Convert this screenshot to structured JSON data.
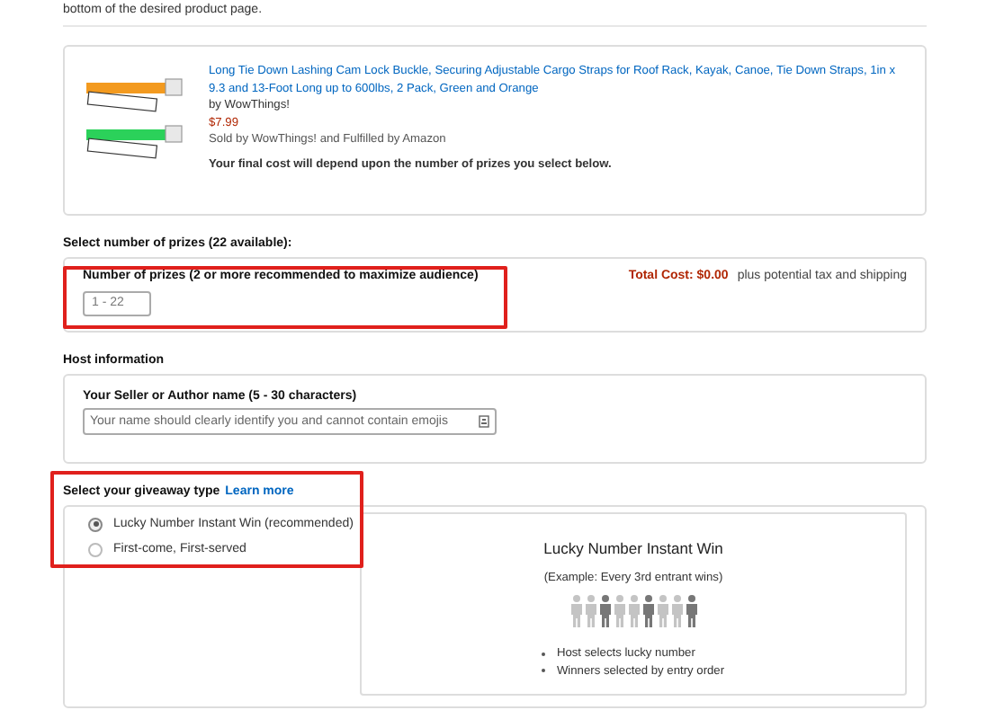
{
  "intro_text": "bottom of the desired product page.",
  "product": {
    "title": "Long Tie Down Lashing Cam Lock Buckle, Securing Adjustable Cargo Straps for Roof Rack, Kayak, Canoe, Tie Down Straps, 1in x 9.3 and 13-Foot Long up to 600lbs, 2 Pack, Green and Orange",
    "brand": "by WowThings!",
    "price": "$7.99",
    "seller": "Sold by WowThings! and Fulfilled by Amazon",
    "note": "Your final cost will depend upon the number of prizes you select below."
  },
  "prizes": {
    "heading": "Select number of prizes (22 available):",
    "label": "Number of prizes (2 or more recommended to maximize audience)",
    "placeholder": "1 - 22",
    "total_label": "Total Cost: $0.00",
    "total_note": "plus potential tax and shipping",
    "highlighted": true
  },
  "host": {
    "heading": "Host information",
    "label": "Your Seller or Author name (5 - 30 characters)",
    "placeholder": "Your name should clearly identify you and cannot contain emojis"
  },
  "giveaway_type": {
    "heading": "Select your giveaway type",
    "link": "Learn more",
    "highlighted": true,
    "options": [
      {
        "label": "Lucky Number Instant Win (recommended)",
        "selected": true
      },
      {
        "label": "First-come, First-served",
        "selected": false
      }
    ],
    "preview": {
      "title": "Lucky Number Instant Win",
      "example": "(Example: Every 3rd entrant wins)",
      "figures": [
        {
          "winner": false
        },
        {
          "winner": false
        },
        {
          "winner": true
        },
        {
          "winner": false
        },
        {
          "winner": false
        },
        {
          "winner": true
        },
        {
          "winner": false
        },
        {
          "winner": false
        },
        {
          "winner": true
        }
      ],
      "bullets": [
        "Host selects lucky number",
        "Winners selected by entry order"
      ]
    }
  }
}
